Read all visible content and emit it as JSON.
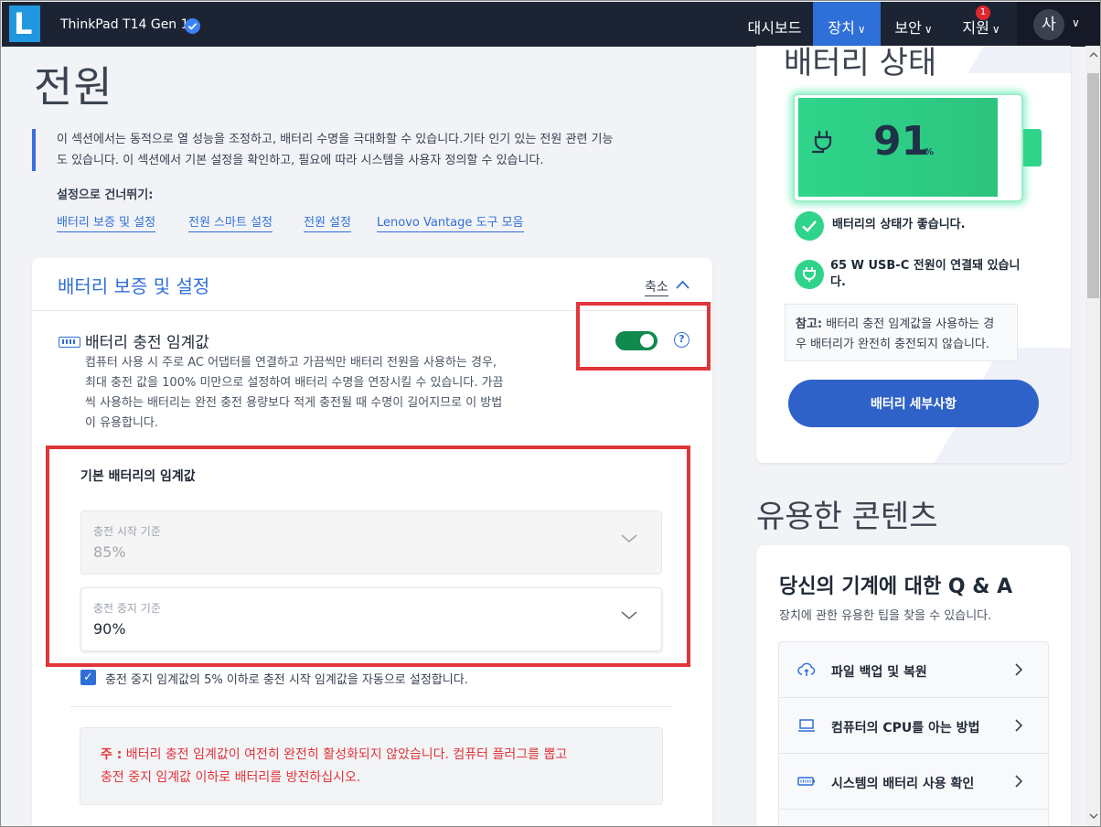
{
  "header": {
    "logo_letter": "L",
    "device_name": "ThinkPad T14 Gen 1",
    "nav": {
      "dashboard": "대시보드",
      "device": "장치",
      "security": "보안",
      "support": "지원",
      "support_badge": "1"
    },
    "user_initial": "사"
  },
  "page": {
    "title": "전원",
    "intro_line1": "이 섹션에서는 동적으로 열 성능을 조정하고, 배터리 수명을 극대화할 수 있습니다.기타 인기 있는 전원 관련 기능",
    "intro_line2": "도 있습니다. 이 섹션에서 기본 설정을 확인하고, 필요에 따라 시스템을 사용자 정의할 수 있습니다.",
    "skip_label": "설정으로 건너뛰기:",
    "skip_links": [
      "배터리 보증 및 설정",
      "전원 스마트 설정",
      "전원 설정",
      "Lenovo Vantage 도구 모음"
    ]
  },
  "battery_card": {
    "title": "배터리 보증 및 설정",
    "collapse_label": "축소",
    "feature_title": "배터리 충전 임계값",
    "feature_desc_lines": [
      "컴퓨터 사용 시 주로 AC 어댑터를 연결하고 가끔씩만 배터리 전원을 사용하는 경우,",
      "최대 충전 값을 100% 미만으로 설정하여 배터리 수명을 연장시킬 수 있습니다. 가끔",
      "씩 사용하는 배터리는 완전 충전 용량보다 적게 충전될 때 수명이 길어지므로 이 방법",
      "이 유용합니다."
    ],
    "toggle_on": true,
    "help_symbol": "?",
    "threshold_title": "기본 배터리의 임계값",
    "start_label": "충전 시작 기준",
    "start_value": "85%",
    "stop_label": "충전 중지 기준",
    "stop_value": "90%",
    "auto_checkbox_checked": true,
    "auto_checkbox_label": "충전 중지 임계값의 5% 이하로 충전 시작 임계값을 자동으로 설정합니다.",
    "note_prefix": "주 :",
    "note_line1": " 배터리 충전 임계값이 여전히 완전히 활성화되지 않았습니다. 컴퓨터 플러그를 뽑고",
    "note_line2": "충전 중지 임계값 이하로 배터리를 방전하십시오."
  },
  "battery_status": {
    "title": "배터리 상태",
    "percent": "91",
    "percent_sign": "%",
    "level_fraction": 0.91,
    "health_text": "배터리의 상태가 좋습니다.",
    "power_line1": "65 W USB-C 전원이 연결돼 있습니",
    "power_line2": "다.",
    "ref_prefix": "참고:",
    "ref_line1": " 배터리 충전 임계값을 사용하는 경",
    "ref_line2": "우 배터리가 완전히 충전되지 않습니다.",
    "details_button": "배터리 세부사항"
  },
  "useful": {
    "title": "유용한 콘텐츠",
    "qa_title": "당신의 기계에 대한 Q & A",
    "qa_sub": "장치에 관한 유용한 팁을 찾을 수 있습니다.",
    "items": [
      {
        "label": "파일 백업 및 복원",
        "icon": "cloud-sync-icon"
      },
      {
        "label": "컴퓨터의 CPU를 아는 방법",
        "icon": "laptop-icon"
      },
      {
        "label": "시스템의 배터리 사용 확인",
        "icon": "battery-icon"
      }
    ]
  },
  "colors": {
    "accent": "#2f6fd8",
    "topbar": "#1c2433",
    "highlight": "#e0353b",
    "battery_green": "#2fd48a"
  }
}
